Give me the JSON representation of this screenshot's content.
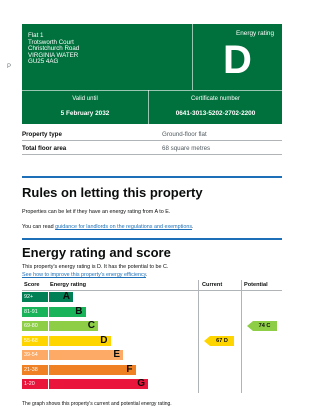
{
  "side_marker": "P",
  "certificate": {
    "address_lines": [
      "Flat 1",
      "Trotsworth Court",
      "Christchurch Road",
      "VIRGINIA WATER",
      "GU25 4AG"
    ],
    "energy_rating_label": "Energy rating",
    "energy_rating": "D",
    "valid_until_label": "Valid until",
    "valid_until": "5 February 2032",
    "certificate_number_label": "Certificate number",
    "certificate_number": "0641-3013-5202-2702-2200",
    "colors": {
      "panel": "#00703c",
      "text": "#ffffff"
    }
  },
  "summary": [
    {
      "key": "Property type",
      "value": "Ground-floor flat"
    },
    {
      "key": "Total floor area",
      "value": "68 square metres"
    }
  ],
  "rules_section": {
    "heading": "Rules on letting this property",
    "para1": "Properties can be let if they have an energy rating from A to E.",
    "para2_prefix": "You can read ",
    "para2_link": "guidance for landlords on the regulations and exemptions",
    "para2_suffix": "."
  },
  "score_section": {
    "heading": "Energy rating and score",
    "para1": "This property's energy rating is D. It has the potential to be C.",
    "improve_link": "See how to improve this property's energy efficiency",
    "improve_suffix": ".",
    "footnote": "The graph shows this property's current and potential energy rating."
  },
  "chart_data": {
    "type": "table",
    "columns": [
      "Score",
      "Energy rating",
      "Current",
      "Potential"
    ],
    "bands": [
      {
        "score": "92+",
        "letter": "A",
        "color": "#008054"
      },
      {
        "score": "81-91",
        "letter": "B",
        "color": "#19b459"
      },
      {
        "score": "69-80",
        "letter": "C",
        "color": "#8dce46"
      },
      {
        "score": "55-68",
        "letter": "D",
        "color": "#ffd500"
      },
      {
        "score": "39-54",
        "letter": "E",
        "color": "#fcaa65"
      },
      {
        "score": "21-38",
        "letter": "F",
        "color": "#ef8023"
      },
      {
        "score": "1-20",
        "letter": "G",
        "color": "#e9153b"
      }
    ],
    "current": {
      "score": 67,
      "letter": "D",
      "label": "67 D",
      "color": "#ffd500"
    },
    "potential": {
      "score": 74,
      "letter": "C",
      "label": "74 C",
      "color": "#8dce46"
    }
  }
}
